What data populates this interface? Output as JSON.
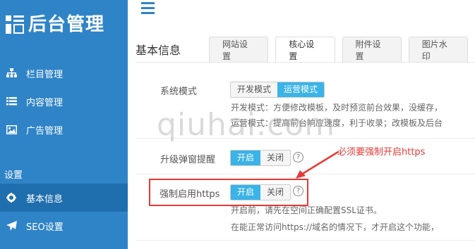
{
  "brand": {
    "logo_text": "后台管理"
  },
  "sidebar": {
    "items": [
      {
        "label": "栏目管理",
        "icon": "sitemap-icon"
      },
      {
        "label": "内容管理",
        "icon": "list-icon"
      },
      {
        "label": "广告管理",
        "icon": "image-icon"
      }
    ],
    "group_title": "设置",
    "settings_items": [
      {
        "label": "基本信息",
        "icon": "gear-icon",
        "active": true
      },
      {
        "label": "SEO设置",
        "icon": "paper-plane-icon"
      }
    ]
  },
  "main": {
    "title": "基本信息",
    "tabs": [
      {
        "label": "网站设置"
      },
      {
        "label": "核心设置",
        "active": true
      },
      {
        "label": "附件设置"
      },
      {
        "label": "图片水印"
      }
    ],
    "settings": {
      "system_mode": {
        "label": "系统模式",
        "options": [
          "开发模式",
          "运营模式"
        ],
        "selected": "运营模式",
        "desc_lines": [
          "开发模式：方便修改模板，及时预览前台效果，没缓存，",
          "运营模式：提高前台响应速度，利于收录；改模板及后台"
        ]
      },
      "upgrade_popup": {
        "label": "升级弹窗提醒",
        "options": [
          "开启",
          "关闭"
        ],
        "selected": "开启"
      },
      "force_https": {
        "label": "强制启用https",
        "options": [
          "开启",
          "关闭"
        ],
        "selected": "开启",
        "desc_lines": [
          "开启前，请先在空间正确配置SSL证书。",
          "在能正常访问https://域名的情况下，才开启这个功能，"
        ]
      }
    }
  },
  "annotation": {
    "text": "必须要强制开启https"
  },
  "watermark": {
    "text": "qiuhai.com"
  },
  "colors": {
    "sidebar": "#2f84c8",
    "accent": "#3ab3e8",
    "annotation": "#e53935"
  }
}
